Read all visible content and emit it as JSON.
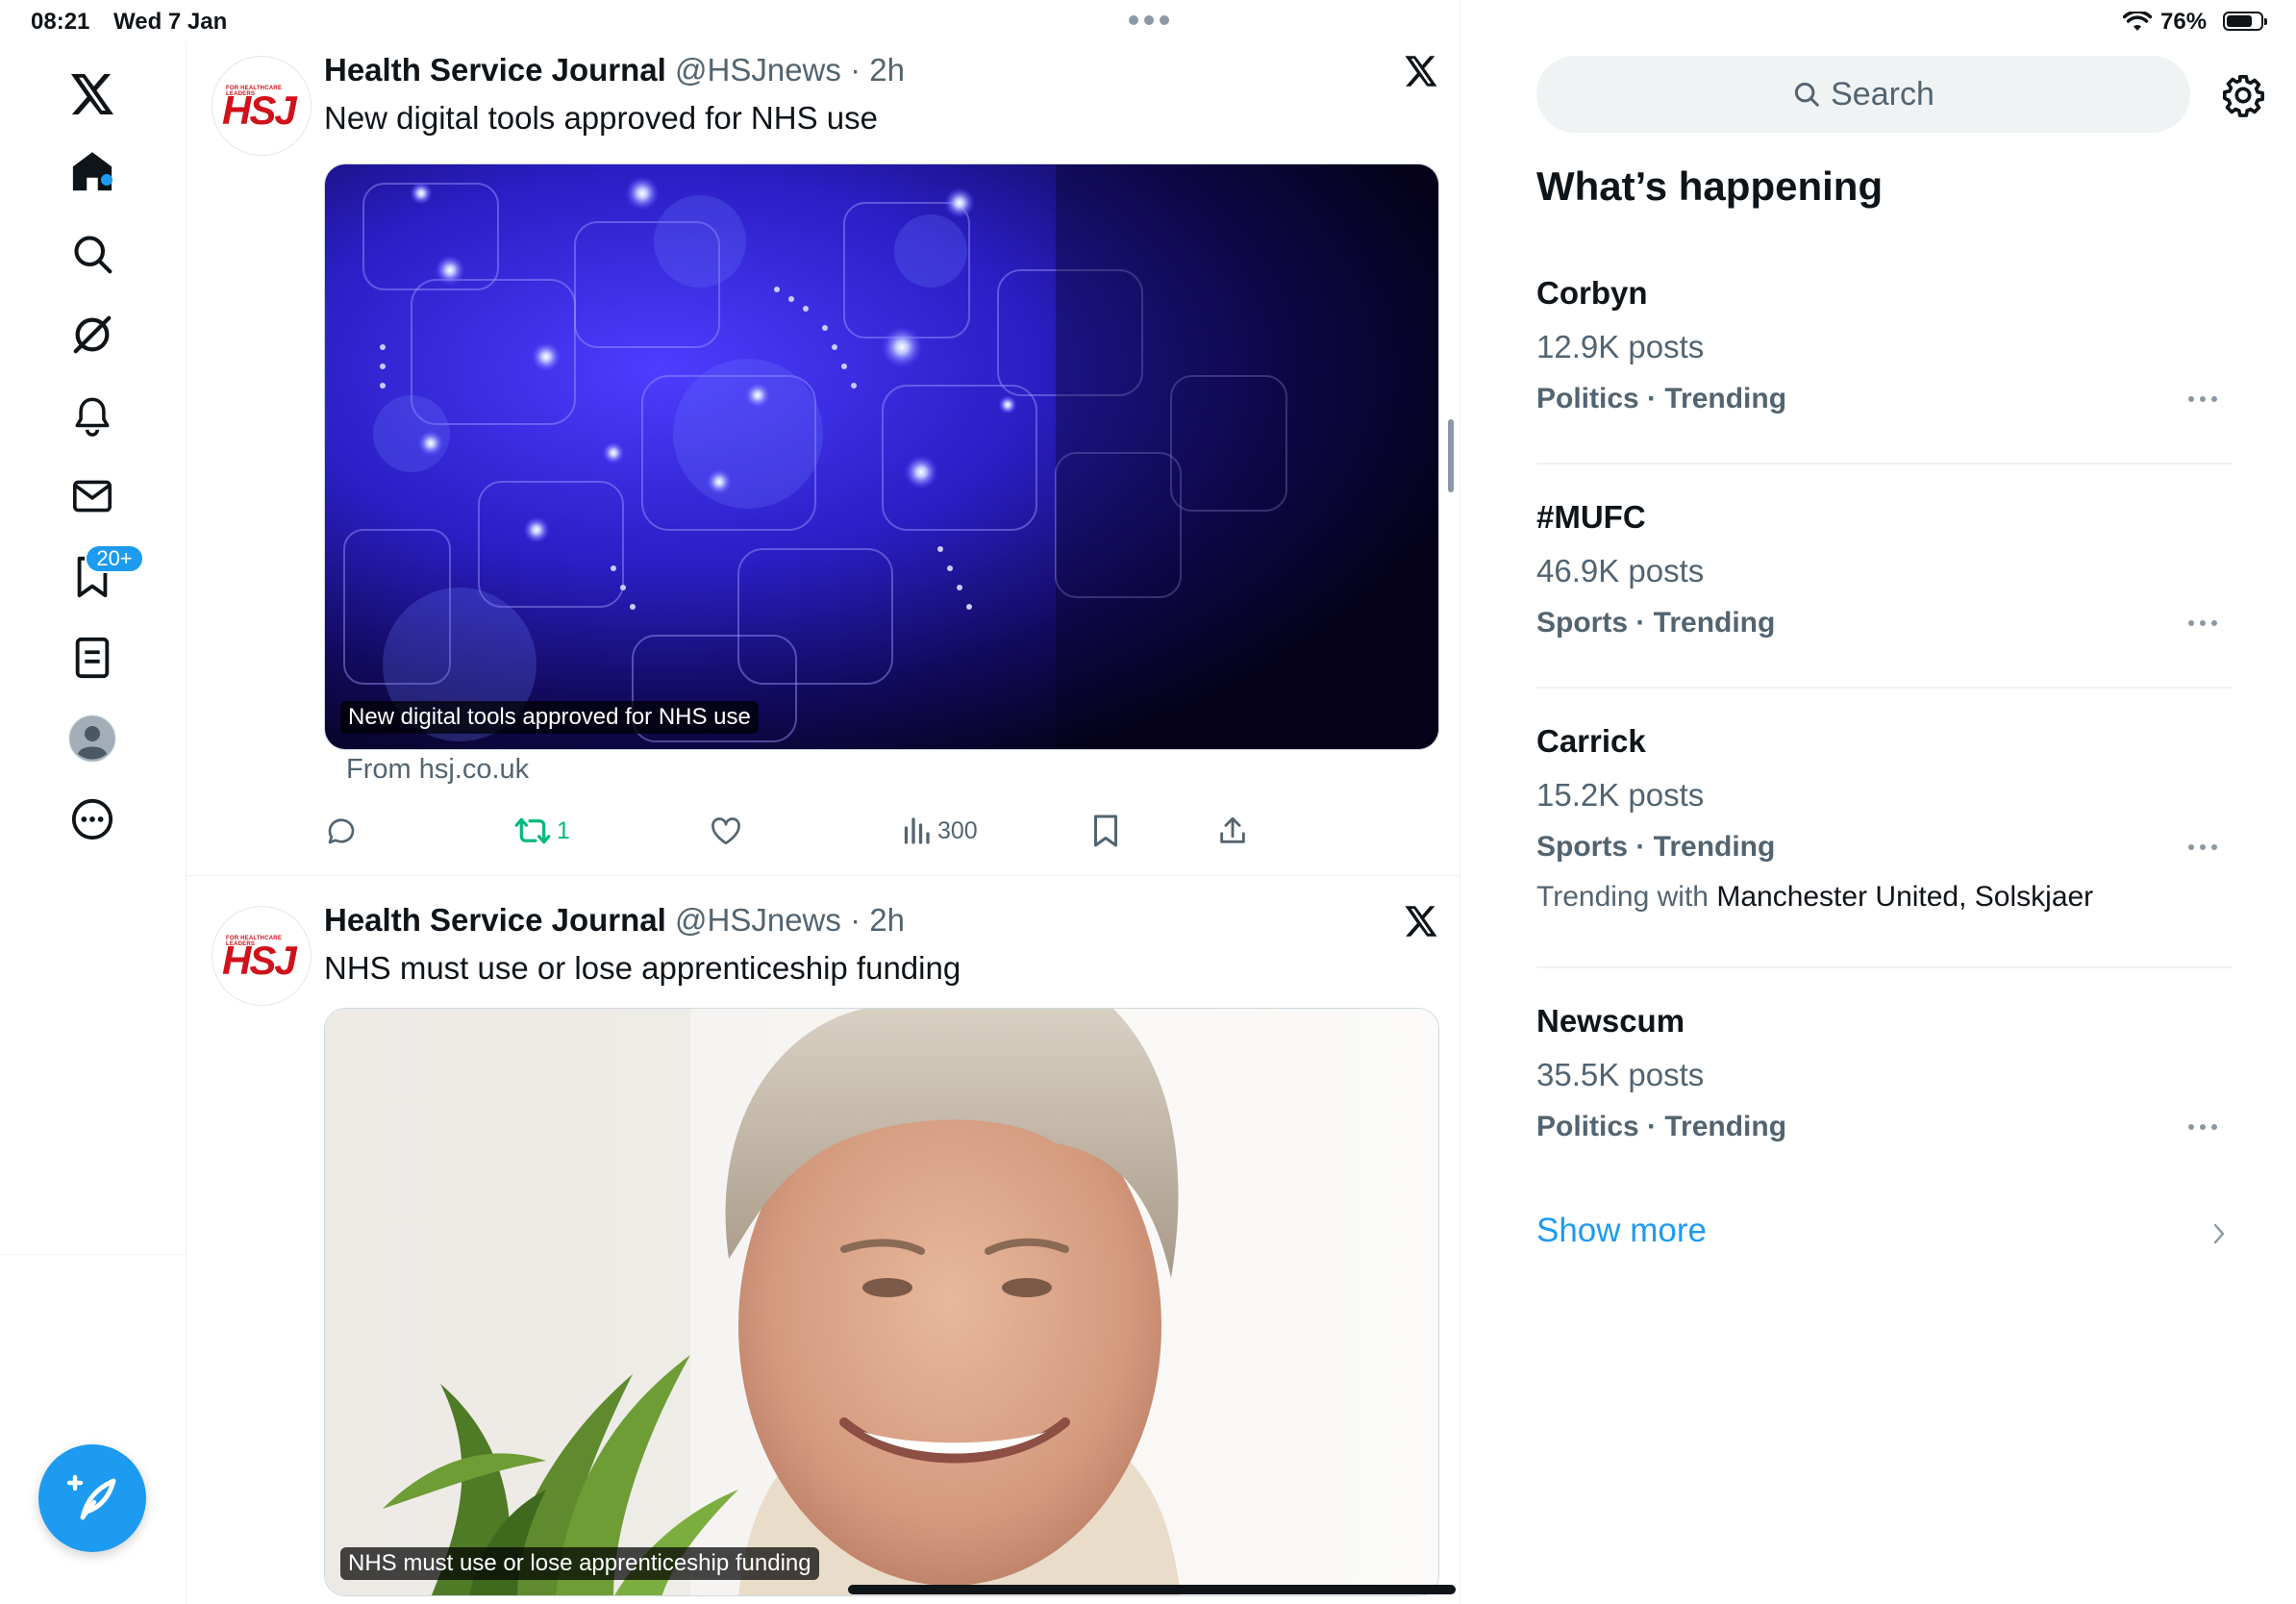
{
  "status_bar": {
    "time": "08:21",
    "date": "Wed 7 Jan",
    "battery_percent": "76%",
    "battery_level": 0.76
  },
  "nav": {
    "notifications_badge": "20+",
    "items": [
      "x-logo",
      "home",
      "search",
      "grok",
      "notifications",
      "messages",
      "bookmarks",
      "lists",
      "profile",
      "more"
    ]
  },
  "timeline": {
    "posts": [
      {
        "author": "Health Service Journal",
        "handle": "@HSJnews",
        "separator": "·",
        "age": "2h",
        "text": "New digital tools approved for NHS use",
        "media_caption": "New digital tools approved for NHS use",
        "source": "From hsj.co.uk",
        "retweets": "1",
        "views": "300"
      },
      {
        "author": "Health Service Journal",
        "handle": "@HSJnews",
        "separator": "·",
        "age": "2h",
        "text": "NHS must use or lose apprenticeship funding",
        "media_caption": "NHS must use or lose apprenticeship funding"
      }
    ]
  },
  "sidebar": {
    "search_placeholder": "Search",
    "heading": "What’s happening",
    "trends": [
      {
        "name": "Corbyn",
        "posts": "12.9K posts",
        "category": "Politics · Trending"
      },
      {
        "name": "#MUFC",
        "posts": "46.9K posts",
        "category": "Sports · Trending"
      },
      {
        "name": "Carrick",
        "posts": "15.2K posts",
        "category": "Sports · Trending",
        "trending_with_label": "Trending with",
        "trending_with": "Manchester United, Solskjaer"
      },
      {
        "name": "Newscum",
        "posts": "35.5K posts",
        "category": "Politics · Trending"
      }
    ],
    "show_more": "Show more"
  },
  "colors": {
    "accent": "#1d9bf0",
    "retweet_green": "#00ba7c",
    "secondary_text": "#536471",
    "brand_red": "#d0121b"
  }
}
